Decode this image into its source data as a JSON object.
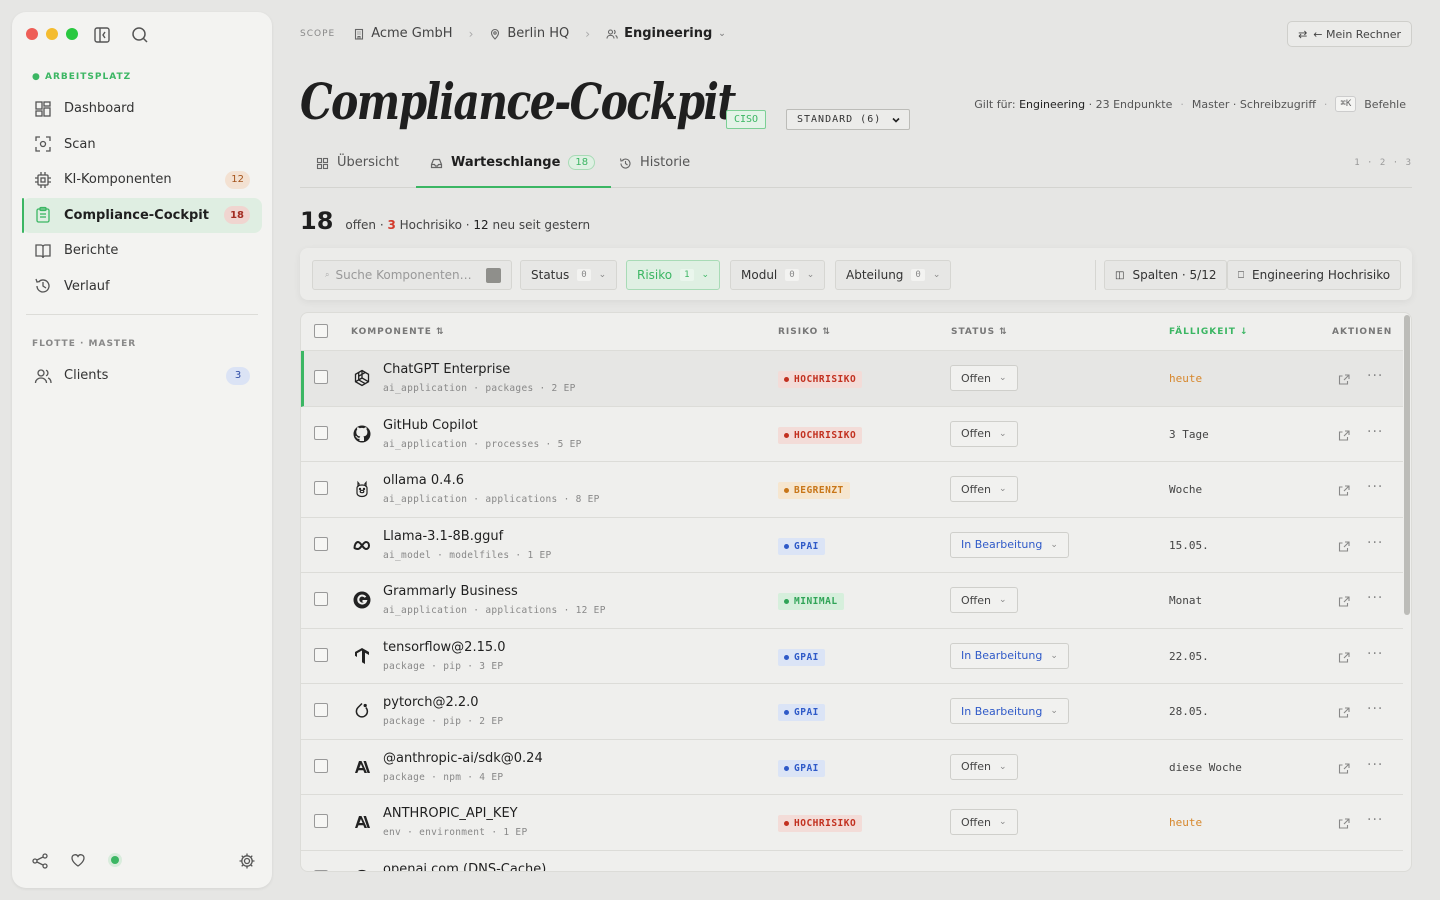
{
  "sidebar": {
    "section_workspace": "ARBEITSPLATZ",
    "nav": [
      {
        "label": "Dashboard",
        "badge": null
      },
      {
        "label": "Scan",
        "badge": null
      },
      {
        "label": "KI-Komponenten",
        "badge": "12"
      },
      {
        "label": "Compliance-Cockpit",
        "badge": "18"
      },
      {
        "label": "Berichte",
        "badge": null
      },
      {
        "label": "Verlauf",
        "badge": null
      }
    ],
    "section_fleet": "FLOTTE · MASTER",
    "clients": {
      "label": "Clients",
      "badge": "3"
    }
  },
  "breadcrumb": {
    "scope": "SCOPE",
    "org": "Acme GmbH",
    "site": "Berlin HQ",
    "team": "Engineering"
  },
  "header": {
    "mein_rechner": "← Mein Rechner",
    "title": "Compliance-Cockpit",
    "role_badge": "CISO",
    "profile_select": "STANDARD (6)",
    "applies_label": "Gilt für:",
    "applies_team": "Engineering",
    "endpoints": "23 Endpunkte",
    "access": "Master · Schreibzugriff",
    "shortcut": "⌘K",
    "commands": "Befehle"
  },
  "tabs": [
    {
      "label": "Übersicht",
      "count": null
    },
    {
      "label": "Warteschlange",
      "count": "18"
    },
    {
      "label": "Historie",
      "count": null
    }
  ],
  "pager": "1 · 2 · 3",
  "summary": {
    "total": "18",
    "open": "offen ·",
    "high_count": "3",
    "high_label": "Hochrisiko ·",
    "new_count": "12",
    "new_label": "neu seit gestern"
  },
  "filters": {
    "search_placeholder": "Suche Komponenten…",
    "status": {
      "label": "Status",
      "count": "0"
    },
    "risiko": {
      "label": "Risiko",
      "count": "1"
    },
    "modul": {
      "label": "Modul",
      "count": "0"
    },
    "abteilung": {
      "label": "Abteilung",
      "count": "0"
    },
    "columns": "Spalten · 5/12",
    "saved_view": "Engineering Hochrisiko"
  },
  "table": {
    "headers": {
      "component": "KOMPONENTE",
      "risk": "RISIKO",
      "status": "STATUS",
      "due": "FÄLLIGKEIT",
      "actions": "AKTIONEN"
    },
    "rows": [
      {
        "name": "ChatGPT Enterprise",
        "sub": "ai_application · packages · 2 EP",
        "icon": "openai-icon",
        "risk": "HOCHRISIKO",
        "risk_level": "high",
        "status": "Offen",
        "due": "heute",
        "urgent": true
      },
      {
        "name": "GitHub Copilot",
        "sub": "ai_application · processes · 5 EP",
        "icon": "github-icon",
        "risk": "HOCHRISIKO",
        "risk_level": "high",
        "status": "Offen",
        "due": "3 Tage",
        "urgent": false
      },
      {
        "name": "ollama 0.4.6",
        "sub": "ai_application · applications · 8 EP",
        "icon": "ollama-icon",
        "risk": "BEGRENZT",
        "risk_level": "limited",
        "status": "Offen",
        "due": "Woche",
        "urgent": false
      },
      {
        "name": "Llama-3.1-8B.gguf",
        "sub": "ai_model · modelfiles · 1 EP",
        "icon": "meta-icon",
        "risk": "GPAI",
        "risk_level": "gpai",
        "status": "In Bearbeitung",
        "due": "15.05.",
        "urgent": false
      },
      {
        "name": "Grammarly Business",
        "sub": "ai_application · applications · 12 EP",
        "icon": "grammarly-icon",
        "risk": "MINIMAL",
        "risk_level": "minimal",
        "status": "Offen",
        "due": "Monat",
        "urgent": false
      },
      {
        "name": "tensorflow@2.15.0",
        "sub": "package · pip · 3 EP",
        "icon": "tensorflow-icon",
        "risk": "GPAI",
        "risk_level": "gpai",
        "status": "In Bearbeitung",
        "due": "22.05.",
        "urgent": false
      },
      {
        "name": "pytorch@2.2.0",
        "sub": "package · pip · 2 EP",
        "icon": "pytorch-icon",
        "risk": "GPAI",
        "risk_level": "gpai",
        "status": "In Bearbeitung",
        "due": "28.05.",
        "urgent": false
      },
      {
        "name": "@anthropic-ai/sdk@0.24",
        "sub": "package · npm · 4 EP",
        "icon": "anthropic-icon",
        "risk": "GPAI",
        "risk_level": "gpai",
        "status": "Offen",
        "due": "diese Woche",
        "urgent": false
      },
      {
        "name": "ANTHROPIC_API_KEY",
        "sub": "env · environment · 1 EP",
        "icon": "anthropic-icon",
        "risk": "HOCHRISIKO",
        "risk_level": "high",
        "status": "Offen",
        "due": "heute",
        "urgent": true
      },
      {
        "name": "openai.com (DNS-Cache)",
        "sub": "",
        "icon": "globe-icon",
        "risk": "",
        "risk_level": "",
        "status": "",
        "due": "",
        "urgent": false
      }
    ]
  },
  "colors": {
    "accent_green": "#3bb663",
    "high_red": "#d33b2c",
    "limited_orange": "#d7872c",
    "gpai_blue": "#2f5ac8"
  }
}
